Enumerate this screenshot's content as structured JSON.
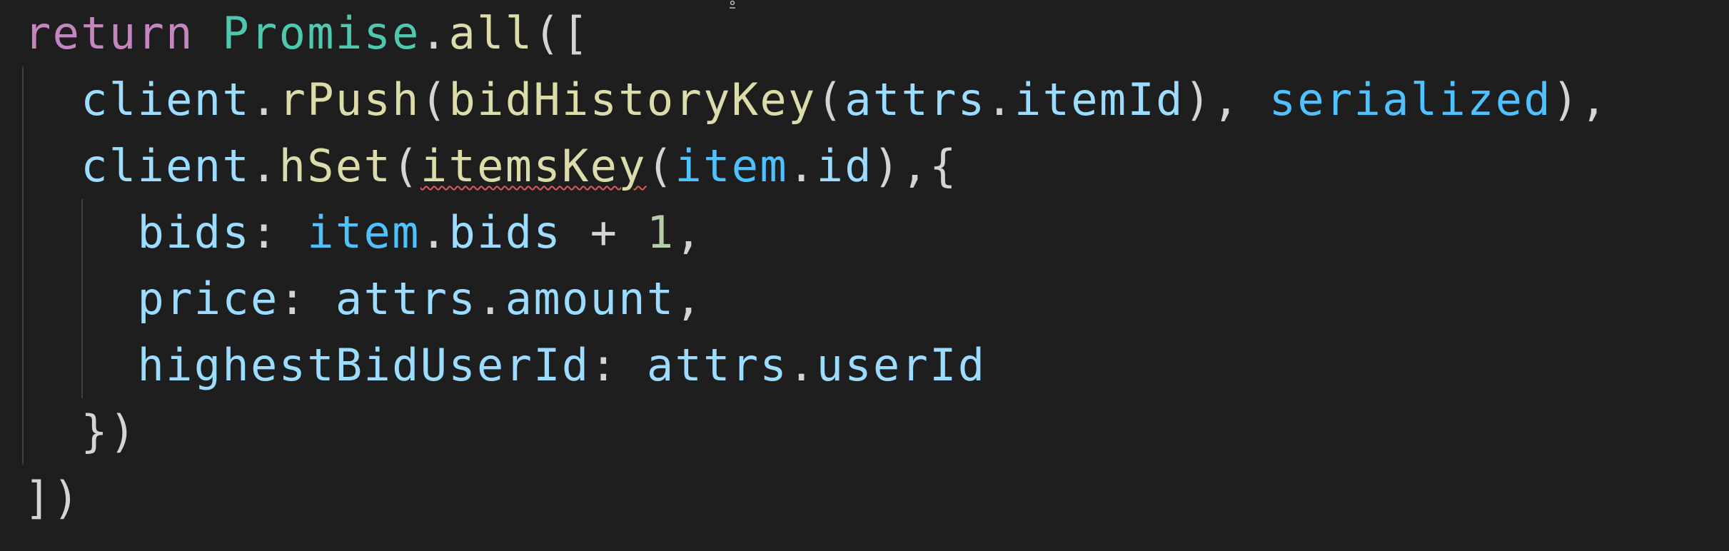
{
  "code": {
    "line1": {
      "kw_return": "return",
      "cls_promise": "Promise",
      "dot": ".",
      "fn_all": "all",
      "open": "(["
    },
    "line2": {
      "var_client": "client",
      "dot": ".",
      "fn_rpush": "rPush",
      "open_paren": "(",
      "fn_bid_history_key": "bidHistoryKey",
      "open_paren2": "(",
      "var_attrs": "attrs",
      "dot2": ".",
      "var_item_id": "itemId",
      "close_comma": "), ",
      "var_serialized": "serialized",
      "close": "),"
    },
    "line3": {
      "var_client": "client",
      "dot": ".",
      "fn_hset": "hSet",
      "open_paren": "(",
      "fn_items_key": "itemsKey",
      "open_paren2": "(",
      "cnst_item": "item",
      "dot2": ".",
      "var_id": "id",
      "close": "),{"
    },
    "line4": {
      "var_bids": "bids",
      "colon": ": ",
      "cnst_item": "item",
      "dot": ".",
      "var_bids2": "bids",
      "plus": " + ",
      "num_one": "1",
      "comma": ","
    },
    "line5": {
      "var_price": "price",
      "colon": ": ",
      "var_attrs": "attrs",
      "dot": ".",
      "var_amount": "amount",
      "comma": ","
    },
    "line6": {
      "var_highest": "highestBidUserId",
      "colon": ": ",
      "var_attrs": "attrs",
      "dot": ".",
      "var_user_id": "userId"
    },
    "line7": {
      "close": "})"
    },
    "line8": {
      "close": "])"
    }
  },
  "colors": {
    "background": "#1e1e1e",
    "keyword": "#c586c0",
    "class": "#4ec9b0",
    "function": "#dcdcaa",
    "variable": "#9cdcfe",
    "constant": "#4fc1ff",
    "number": "#b5cea8",
    "punctuation": "#d4d4d4",
    "error_squiggle": "#e05a5a"
  }
}
